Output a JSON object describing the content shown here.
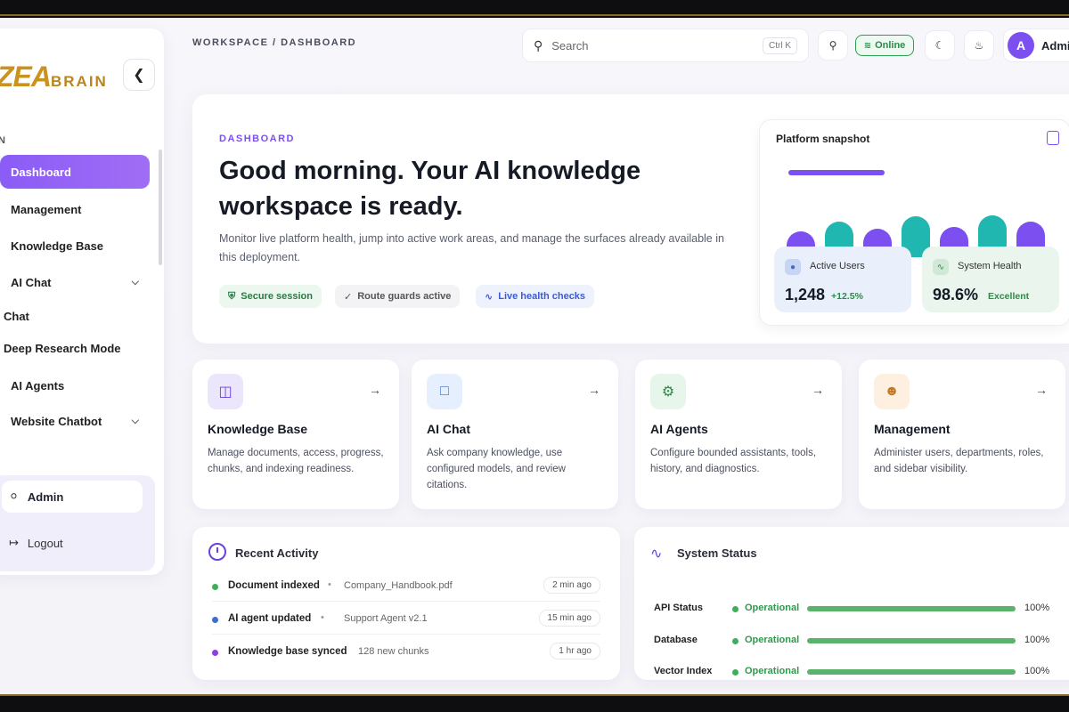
{
  "brand": {
    "logo_big": "ZEA",
    "logo_small": "BRAIN"
  },
  "sidebar": {
    "section": "IN",
    "items": [
      {
        "label": "Dashboard",
        "active": true
      },
      {
        "label": "Management"
      },
      {
        "label": "Knowledge Base"
      },
      {
        "label": "AI Chat",
        "expandable": true
      },
      {
        "label": "Chat"
      },
      {
        "label": "Deep Research Mode"
      },
      {
        "label": "AI Agents"
      },
      {
        "label": "Website Chatbot",
        "expandable": true
      }
    ],
    "admin_label": "Admin",
    "logout_label": "Logout"
  },
  "topbar": {
    "breadcrumb": "WORKSPACE / DASHBOARD",
    "search_placeholder": "Search",
    "search_shortcut": "Ctrl K",
    "online_label": "Online",
    "user_initial": "A",
    "user_name": "Admin"
  },
  "hero": {
    "label": "DASHBOARD",
    "title": "Good morning. Your AI knowledge workspace is ready.",
    "description": "Monitor live platform health, jump into active work areas, and manage the surfaces already available in this deployment.",
    "chips": [
      "Secure session",
      "Route guards active",
      "Live health checks"
    ]
  },
  "snapshot": {
    "title": "Platform snapshot",
    "bar_levels": [
      0.35,
      0.6,
      0.4,
      0.72,
      0.45,
      0.75,
      0.6
    ],
    "bar_colors": [
      "#7c4ff0",
      "#1fb7b0",
      "#7c4ff0",
      "#1fb7b0",
      "#7c4ff0",
      "#1fb7b0",
      "#7c4ff0"
    ],
    "active_users": {
      "label": "Active Users",
      "value": "1,248",
      "delta": "+12.5%"
    },
    "system_health": {
      "label": "System Health",
      "value": "98.6%",
      "delta": "Excellent"
    }
  },
  "cards": [
    {
      "title": "Knowledge Base",
      "description": "Manage documents, access, progress, chunks, and indexing readiness.",
      "icon": "database-icon",
      "icon_bg": "#ece6fd",
      "icon_color": "#6b3fe0"
    },
    {
      "title": "AI Chat",
      "description": "Ask company knowledge, use configured models, and review citations.",
      "icon": "chat-icon",
      "icon_bg": "#e6effd",
      "icon_color": "#3c6fd6"
    },
    {
      "title": "AI Agents",
      "description": "Configure bounded assistants, tools, history, and diagnostics.",
      "icon": "robot-icon",
      "icon_bg": "#e6f6ea",
      "icon_color": "#2e8a4a"
    },
    {
      "title": "Management",
      "description": "Administer users, departments, roles, and sidebar visibility.",
      "icon": "users-icon",
      "icon_bg": "#fdf0e1",
      "icon_color": "#c27a22"
    }
  ],
  "activity": {
    "title": "Recent Activity",
    "rows": [
      {
        "title": "Document indexed",
        "detail": "Company_Handbook.pdf",
        "time": "2 min ago",
        "color": "#3fae5a"
      },
      {
        "title": "AI agent updated",
        "detail": "Support Agent v2.1",
        "time": "15 min ago",
        "color": "#3c6fd6"
      },
      {
        "title": "Knowledge base synced",
        "detail": "128 new chunks",
        "time": "1 hr ago",
        "color": "#8b3fe0"
      }
    ]
  },
  "status": {
    "title": "System Status",
    "rows": [
      {
        "label": "API Status",
        "state": "Operational",
        "percent": 100,
        "percent_label": "100%"
      },
      {
        "label": "Database",
        "state": "Operational",
        "percent": 100,
        "percent_label": "100%"
      },
      {
        "label": "Vector Index",
        "state": "Operational",
        "percent": 100,
        "percent_label": "100%"
      }
    ]
  }
}
